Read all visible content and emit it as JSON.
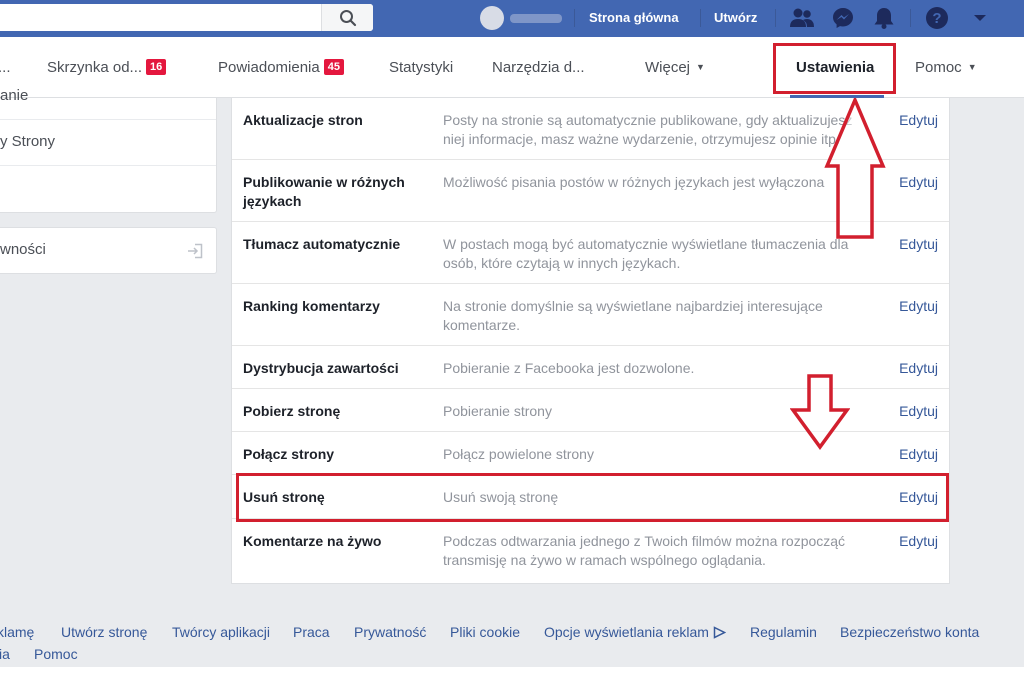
{
  "topbar": {
    "search_placeholder": "",
    "home_label": "Strona główna",
    "create_label": "Utwórz"
  },
  "tabs": [
    {
      "label": "..."
    },
    {
      "label": "Skrzynka od...",
      "badge": "16"
    },
    {
      "label": "Powiadomienia",
      "badge": "45"
    },
    {
      "label": "Statystyki"
    },
    {
      "label": "Narzędzia d..."
    },
    {
      "label": "Więcej"
    },
    {
      "label": "Ustawienia"
    },
    {
      "label": "Pomoc"
    }
  ],
  "sidebar": {
    "items": [
      {
        "label": "anie"
      },
      {
        "label": "y Strony"
      }
    ],
    "card2_label": "wności"
  },
  "settings": {
    "edit_label": "Edytuj",
    "rows": [
      {
        "name": "Aktualizacje stron",
        "desc": "Posty na stronie są automatycznie publikowane, gdy aktualizujesz niej informacje, masz ważne wydarzenie, otrzymujesz opinie itp."
      },
      {
        "name": "Publikowanie w różnych językach",
        "desc": "Możliwość pisania postów w różnych językach jest wyłączona"
      },
      {
        "name": "Tłumacz automatycznie",
        "desc": "W postach mogą być automatycznie wyświetlane tłumaczenia dla osób, które czytają w innych językach."
      },
      {
        "name": "Ranking komentarzy",
        "desc": "Na stronie domyślnie są wyświetlane najbardziej interesujące komentarze."
      },
      {
        "name": "Dystrybucja zawartości",
        "desc": "Pobieranie z Facebooka jest dozwolone."
      },
      {
        "name": "Pobierz stronę",
        "desc": "Pobieranie strony"
      },
      {
        "name": "Połącz strony",
        "desc": "Połącz powielone strony"
      },
      {
        "name": "Usuń stronę",
        "desc": "Usuń swoją stronę"
      },
      {
        "name": "Komentarze na żywo",
        "desc": "Podczas odtwarzania jednego z Twoich filmów można rozpocząć transmisję na żywo w ramach wspólnego oglądania."
      }
    ]
  },
  "footer": {
    "row1": [
      "klamę",
      "Utwórz stronę",
      "Twórcy aplikacji",
      "Praca",
      "Prywatność",
      "Pliki cookie",
      "Opcje wyświetlania reklam",
      "Regulamin",
      "Bezpieczeństwo konta"
    ],
    "row2": [
      "ia",
      "Pomoc"
    ]
  },
  "colors": {
    "brand_blue": "#4267b2",
    "badge_red": "#e4173e",
    "annotation_red": "#d21f2e",
    "link_blue": "#365899"
  }
}
